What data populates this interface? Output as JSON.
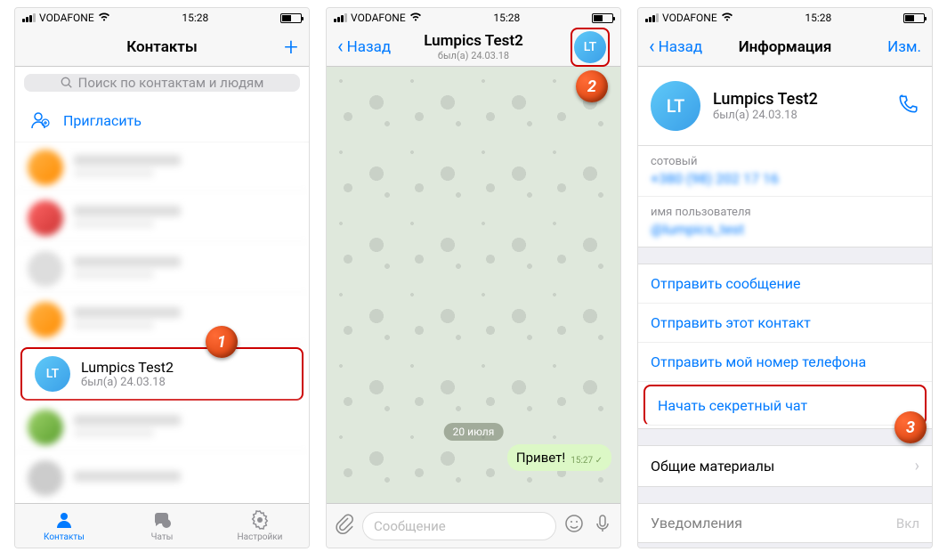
{
  "status": {
    "carrier": "VODAFONE",
    "time": "15:28"
  },
  "screen1": {
    "title": "Контакты",
    "searchPlaceholder": "Поиск по контактам и людям",
    "invite": "Пригласить",
    "contacts": [
      {
        "name": "Lumpics Test2",
        "sub": "был(а) 24.03.18",
        "initials": "LT"
      }
    ],
    "tabs": {
      "contacts": "Контакты",
      "chats": "Чаты",
      "settings": "Настройки"
    }
  },
  "screen2": {
    "back": "Назад",
    "title": "Lumpics Test2",
    "sub": "был(а) 24.03.18",
    "initials": "LT",
    "date": "20 июля",
    "message": "Привет!",
    "msgTime": "15:27",
    "placeholder": "Сообщение"
  },
  "screen3": {
    "back": "Назад",
    "title": "Информация",
    "edit": "Изм.",
    "name": "Lumpics Test2",
    "sub": "был(а) 24.03.18",
    "initials": "LT",
    "mobileLabel": "сотовый",
    "mobileValue": "+380 (98) 202 17 16",
    "usernameLabel": "имя пользователя",
    "usernameValue": "@lumpics_test",
    "actions": {
      "send": "Отправить сообщение",
      "share": "Отправить этот контакт",
      "sendNum": "Отправить мой номер телефона",
      "secret": "Начать секретный чат"
    },
    "shared": "Общие материалы",
    "notif": "Уведомления",
    "notifVal": "Вкл"
  }
}
